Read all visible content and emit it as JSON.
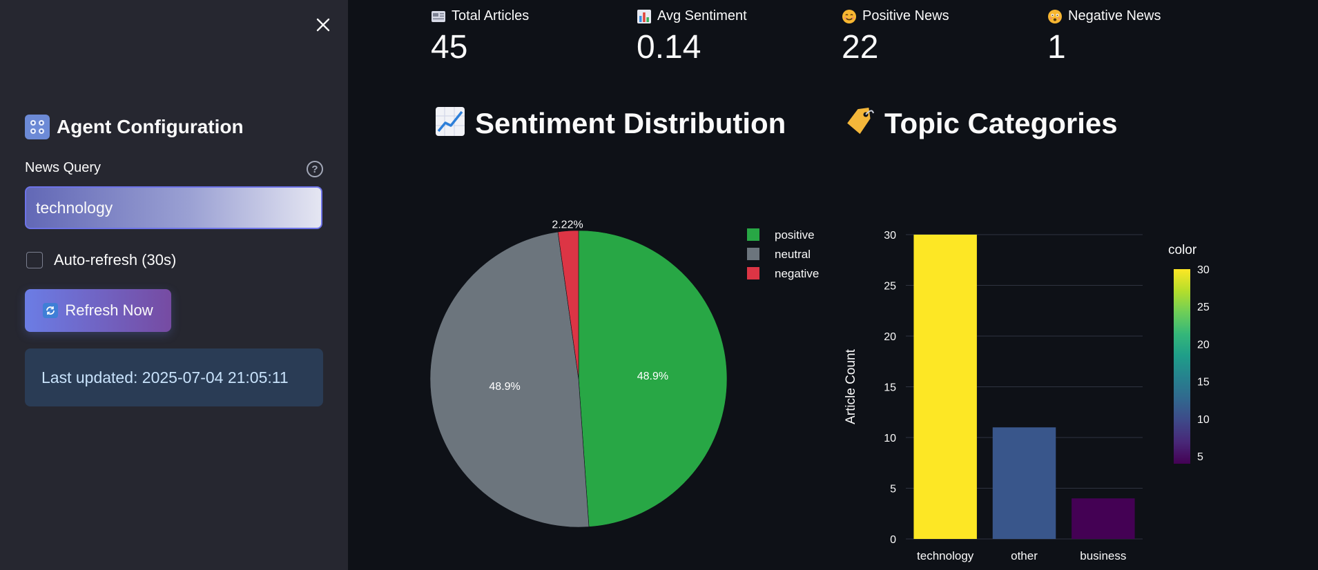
{
  "sidebar": {
    "title": "Agent Configuration",
    "query_label": "News Query",
    "query_value": "technology",
    "autorefresh_label": "Auto-refresh (30s)",
    "refresh_button": "Refresh Now",
    "last_updated": "Last updated: 2025-07-04 21:05:11"
  },
  "metrics": [
    {
      "label": "Total Articles",
      "value": "45",
      "icon": "newspaper-icon"
    },
    {
      "label": "Avg Sentiment",
      "value": "0.14",
      "icon": "bar-chart-icon"
    },
    {
      "label": "Positive News",
      "value": "22",
      "icon": "smiling-face-icon"
    },
    {
      "label": "Negative News",
      "value": "1",
      "icon": "worried-face-icon"
    }
  ],
  "sections": {
    "sentiment_title": "Sentiment Distribution",
    "topic_title": "Topic Categories"
  },
  "colors": {
    "positive": "#28a745",
    "neutral": "#6c757d",
    "negative": "#dc3545",
    "accent": "#667eea"
  },
  "chart_data": [
    {
      "type": "pie",
      "labels": [
        "positive",
        "neutral",
        "negative"
      ],
      "values": [
        22,
        22,
        1
      ],
      "percent_labels": [
        "48.9%",
        "48.9%",
        "2.22%"
      ],
      "colors": [
        "#28a745",
        "#6c757d",
        "#dc3545"
      ],
      "legend": "top-right"
    },
    {
      "type": "bar",
      "categories": [
        "technology",
        "other",
        "business"
      ],
      "values": [
        30,
        11,
        4
      ],
      "ylabel": "Article Count",
      "ylim": [
        0,
        30
      ],
      "yticks": [
        0,
        5,
        10,
        15,
        20,
        25,
        30
      ],
      "colorbar_title": "color",
      "colorbar_ticks": [
        30,
        25,
        20,
        15,
        10,
        5
      ],
      "colorscale": "viridis",
      "grid": true
    }
  ]
}
